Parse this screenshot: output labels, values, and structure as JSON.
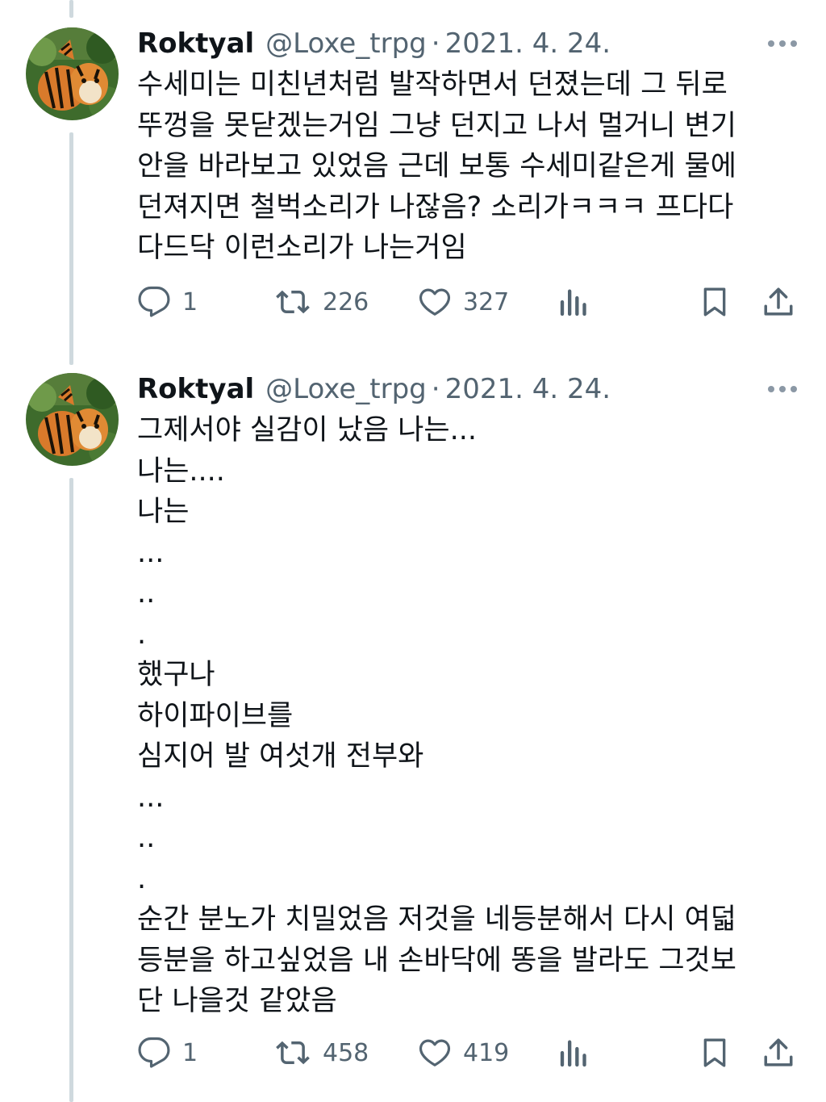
{
  "tweets": [
    {
      "author": {
        "name": "Roktyal",
        "handle": "@Loxe_trpg",
        "separator": "·",
        "date": "2021. 4. 24."
      },
      "lines": [
        "수세미는 미친년처럼 발작하면서 던졌는데 그 뒤로",
        "뚜껑을 못닫겠는거임 그냥 던지고 나서 멀거니 변기",
        "안을 바라보고 있었음 근데 보통 수세미같은게 물에",
        "던져지면 철벅소리가 나잖음? 소리가ㅋㅋㅋ 프다다",
        "다드닥 이런소리가 나는거임"
      ],
      "stats": {
        "replies": "1",
        "retweets": "226",
        "likes": "327"
      }
    },
    {
      "author": {
        "name": "Roktyal",
        "handle": "@Loxe_trpg",
        "separator": "·",
        "date": "2021. 4. 24."
      },
      "lines": [
        "그제서야 실감이 났음 나는...",
        "나는....",
        "나는",
        "...",
        "..",
        ".",
        "했구나",
        "하이파이브를",
        "심지어 발 여섯개 전부와",
        "...",
        "..",
        ".",
        "순간 분노가 치밀었음 저것을 네등분해서 다시 여덟",
        "등분을 하고싶었음 내 손바닥에 똥을 발라도 그것보",
        "단 나을것 같았음"
      ],
      "stats": {
        "replies": "1",
        "retweets": "458",
        "likes": "419"
      }
    }
  ],
  "icons": {
    "reply": "reply-icon",
    "retweet": "retweet-icon",
    "like": "heart-icon",
    "views": "views-icon",
    "bookmark": "bookmark-icon",
    "share": "share-icon",
    "more": "more-icon"
  },
  "colors": {
    "text": "#0f1419",
    "secondary": "#536471",
    "thread_line": "#cfd9de"
  }
}
